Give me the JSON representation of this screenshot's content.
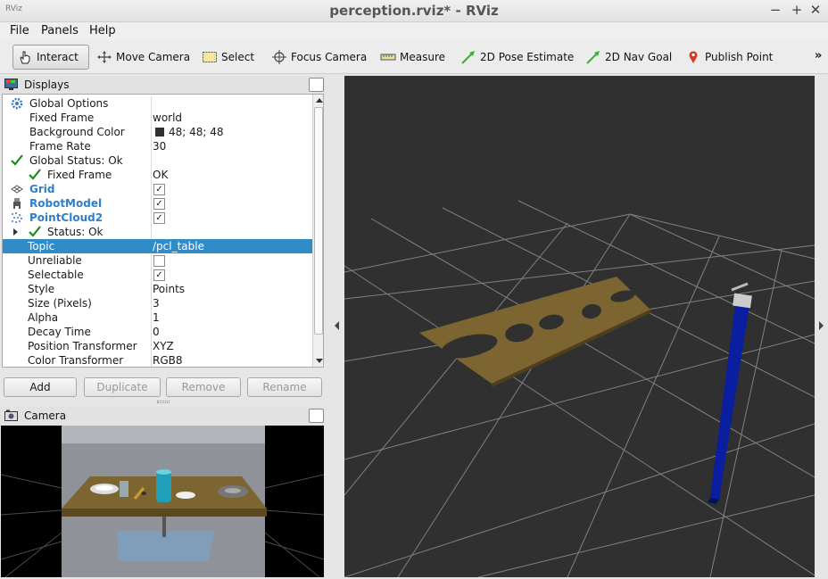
{
  "window": {
    "title": "perception.rviz* - RViz",
    "icon_text": "RViz",
    "buttons": {
      "minimize": "−",
      "maximize": "+",
      "close": "✕"
    }
  },
  "menu": [
    "File",
    "Panels",
    "Help"
  ],
  "toolbar": {
    "tools": [
      "Interact",
      "Move Camera",
      "Select",
      "Focus Camera",
      "Measure",
      "2D Pose Estimate",
      "2D Nav Goal",
      "Publish Point"
    ],
    "overflow": "»"
  },
  "displays_panel": {
    "title": "Displays",
    "rows": [
      {
        "name": "Global Options",
        "value": ""
      },
      {
        "name": "Fixed Frame",
        "value": "world"
      },
      {
        "name": "Background Color",
        "value": "48; 48; 48"
      },
      {
        "name": "Frame Rate",
        "value": "30"
      },
      {
        "name": "Global Status: Ok",
        "value": ""
      },
      {
        "name": "Fixed Frame",
        "value": "OK"
      },
      {
        "name": "Grid",
        "value": ""
      },
      {
        "name": "RobotModel",
        "value": ""
      },
      {
        "name": "PointCloud2",
        "value": ""
      },
      {
        "name": "Status: Ok",
        "value": ""
      },
      {
        "name": "Topic",
        "value": "/pcl_table"
      },
      {
        "name": "Unreliable",
        "value": ""
      },
      {
        "name": "Selectable",
        "value": ""
      },
      {
        "name": "Style",
        "value": "Points"
      },
      {
        "name": "Size (Pixels)",
        "value": "3"
      },
      {
        "name": "Alpha",
        "value": "1"
      },
      {
        "name": "Decay Time",
        "value": "0"
      },
      {
        "name": "Position Transformer",
        "value": "XYZ"
      },
      {
        "name": "Color Transformer",
        "value": "RGB8"
      }
    ],
    "checkbox_states": {
      "grid": true,
      "robot_model": true,
      "point_cloud2": true,
      "unreliable": false,
      "selectable": true
    },
    "check_mark": "✓",
    "background_color_swatch": "#303030",
    "buttons": [
      "Add",
      "Duplicate",
      "Remove",
      "Rename"
    ]
  },
  "camera_panel": {
    "title": "Camera"
  },
  "colors": {
    "selection": "#308cc6",
    "link_blue": "#2e7fc9",
    "status_ok": "#1e8a1e",
    "viewport_bg": "#303030",
    "table_brown": "#7d6531",
    "robot_blue": "#0a1ea0"
  }
}
